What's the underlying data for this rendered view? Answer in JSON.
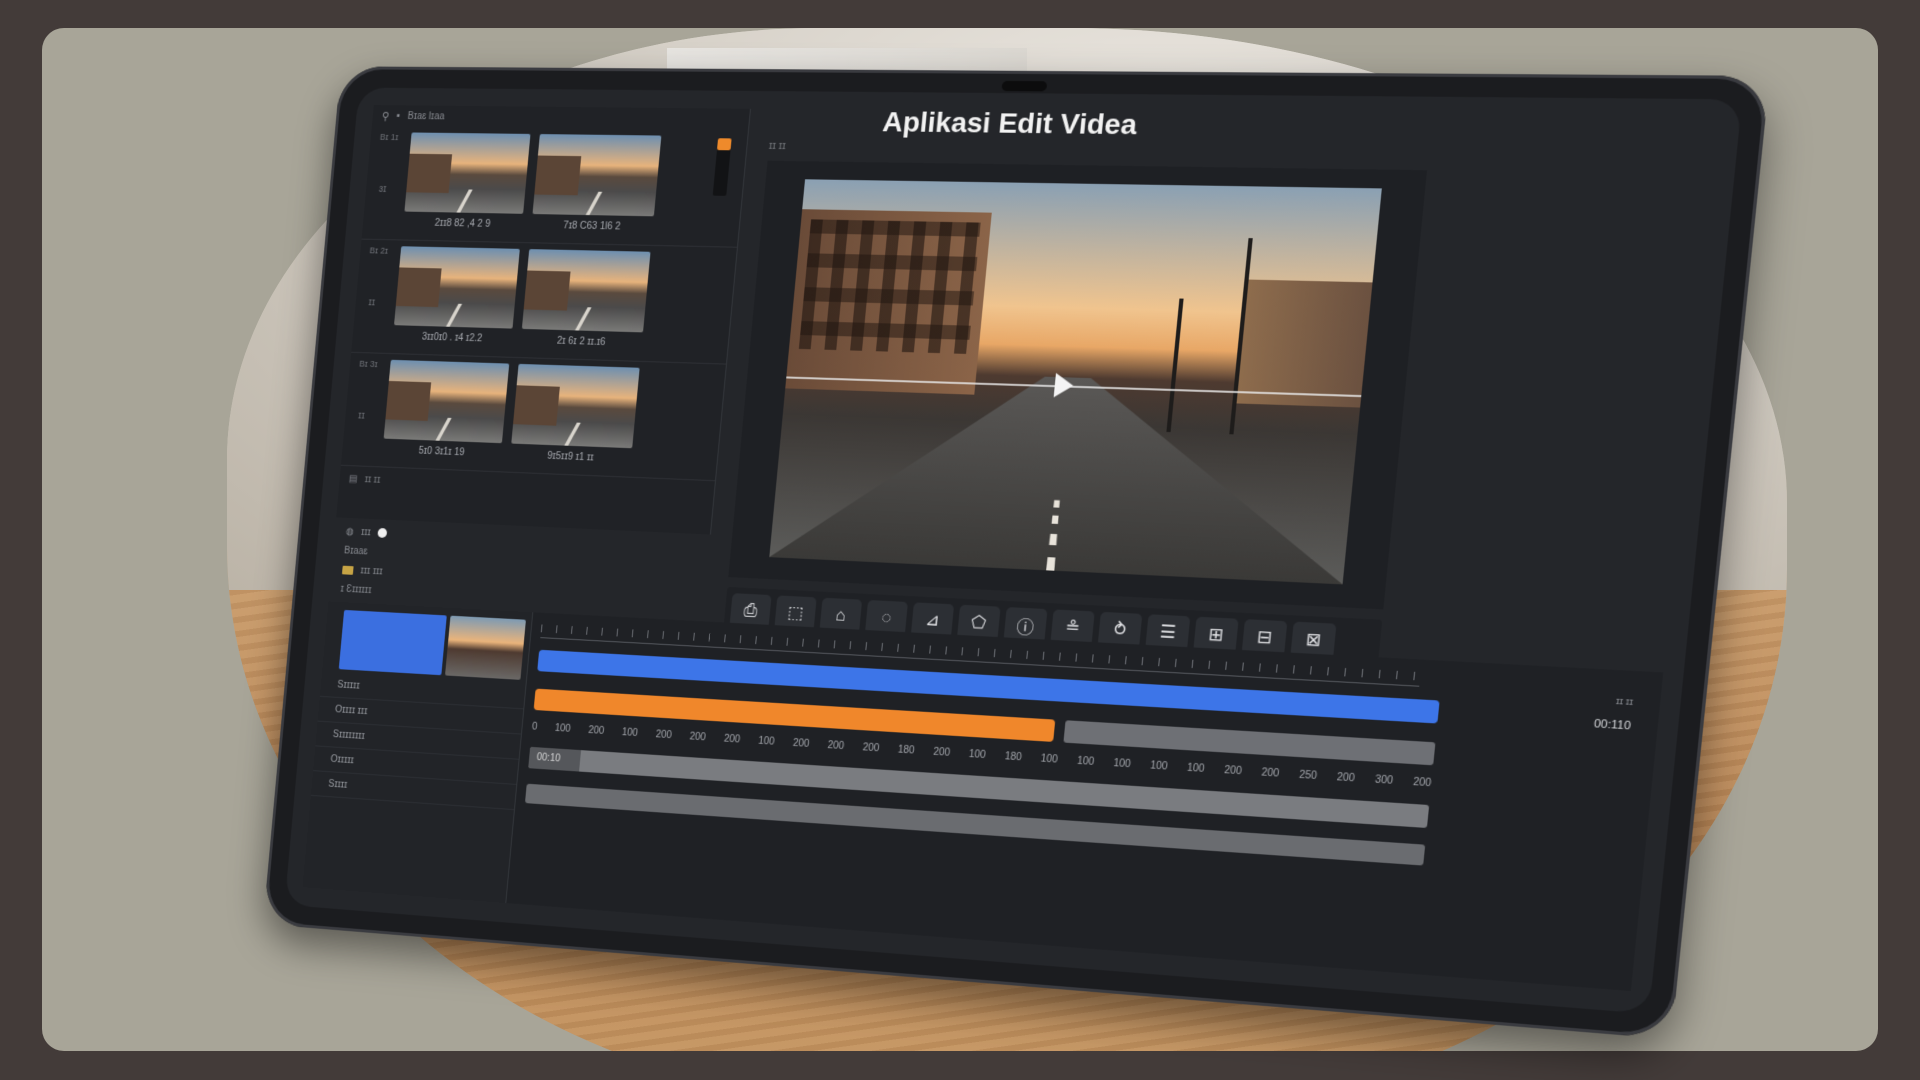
{
  "app": {
    "title": "Aplikasi Edit Videa"
  },
  "media_panel": {
    "header": "Bɪaɛ  lɪaa",
    "groups": [
      {
        "tag": "Bɪ 1ɪ",
        "side": "ɜɪ",
        "captions": [
          "2ɪɪ8 82 ,4 2 9",
          "7ɪ8 C63 1l6 2"
        ]
      },
      {
        "tag": "Bɪ 2ɪ",
        "side": "ɪɪ",
        "captions": [
          "3ɪɪ0ɪ0 . ɪ4 ɪ2.2",
          "2ɪ 6ɪ 2 ɪɪ.ɪ6"
        ]
      },
      {
        "tag": "Bɪ 3ɪ",
        "side": "ɪɪ",
        "captions": [
          "5ɪ0 3ɪ1ɪ 19",
          "9ɪ5ɪɪ9 ɪ1 ɪɪ"
        ]
      }
    ],
    "footer": "ɪɪ ɪɪ"
  },
  "tracks_head": {
    "row1": "ɪɪɪ",
    "row2": "Bɪaaɛ",
    "row3": "ɪɪɪ ɪɪɪ",
    "row4": "ɪ  Ɛɪɪɪɪɪɪ"
  },
  "preview_ctrl": "ɪɪ ɪɪ",
  "toolbar": {
    "tools": [
      "⎙",
      "⬚",
      "⌂",
      "◌",
      "⊿",
      "⬠",
      "ⓘ",
      "≗",
      "⥁",
      "☰",
      "⊞",
      "⊟",
      "⊠"
    ]
  },
  "timeline": {
    "track_labels": [
      "Sɪɪɪɪɪ",
      "Oɪɪɪɪ ɪɪɪ",
      "Sɪɪɪɪɪɪɪɪ",
      "Oɪɪɪɪɪ",
      "Sɪɪɪɪ"
    ],
    "scale": [
      "0",
      "100",
      "200",
      "100",
      "200",
      "200",
      "200",
      "100",
      "200",
      "200",
      "200",
      "180",
      "200",
      "100",
      "180",
      "100",
      "100",
      "100",
      "100",
      "100",
      "200",
      "200",
      "250",
      "200",
      "300",
      "200"
    ],
    "start_time": "00:10",
    "time_readout": "00:110",
    "zoom": "ɪɪ ɪɪ"
  },
  "colors": {
    "accent_blue": "#3d75e8",
    "accent_orange": "#f0872b",
    "background": "#433b39",
    "card": "#a8a598"
  }
}
